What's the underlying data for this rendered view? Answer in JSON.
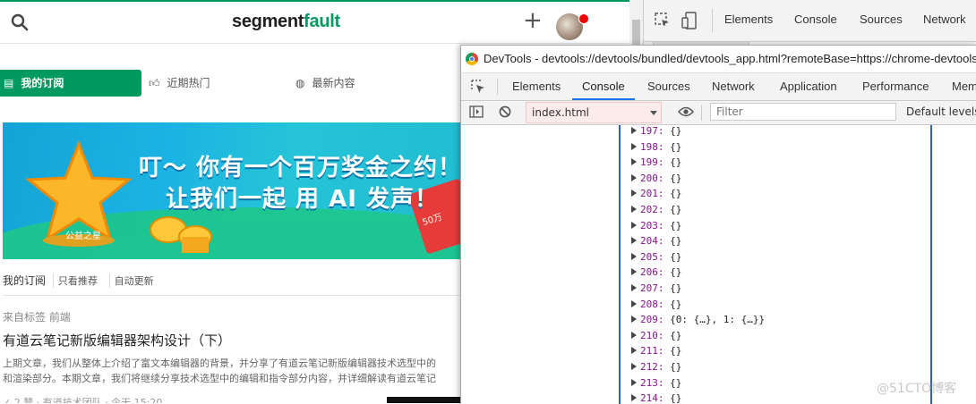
{
  "site": {
    "logo_dark": "segment",
    "logo_green": "fault",
    "plus_glyph": "+"
  },
  "nav": {
    "items": [
      {
        "label": "我的订阅",
        "icon": "subscription-icon",
        "active": true
      },
      {
        "label": "近期热门",
        "icon": "thumb-up-icon",
        "active": false
      },
      {
        "label": "最新内容",
        "icon": "compass-icon",
        "active": false
      }
    ]
  },
  "banner": {
    "line1": "叮～ 你有一个百万奖金之约！",
    "line2": "让我们一起 用 AI 发声！",
    "star_text": "公益之星",
    "envelope_text": "50万"
  },
  "feed": {
    "tab_main": "我的订阅",
    "tab_recommend": "只看推荐",
    "tab_auto": "自动更新",
    "from": "来自标签 前端",
    "title": "有道云笔记新版编辑器架构设计（下）",
    "excerpt1": "上期文章，我们从整体上介绍了富文本编辑器的背景，并分享了有道云笔记新版编辑器技术选型中的",
    "excerpt2": "和渲染部分。本期文章，我们将继续分享技术选型中的编辑和指令部分内容，并详细解读有道云笔记",
    "meta": "✓  2  赞 · 有道技术团队 · 今天 15:20"
  },
  "dock": {
    "tabs": [
      "Elements",
      "Console",
      "Sources",
      "Network"
    ]
  },
  "devtools": {
    "window_title": "DevTools - devtools://devtools/bundled/devtools_app.html?remoteBase=https://chrome-devtools-frontend",
    "tabs": [
      {
        "label": "Elements",
        "active": false
      },
      {
        "label": "Console",
        "active": true
      },
      {
        "label": "Sources",
        "active": false
      },
      {
        "label": "Network",
        "active": false
      },
      {
        "label": "Application",
        "active": false
      },
      {
        "label": "Performance",
        "active": false
      },
      {
        "label": "Mem",
        "active": false
      }
    ],
    "context": "index.html",
    "filter_placeholder": "Filter",
    "levels": "Default levels"
  },
  "console": {
    "rows": [
      {
        "index": "197:",
        "value": "{}"
      },
      {
        "index": "198:",
        "value": "{}"
      },
      {
        "index": "199:",
        "value": "{}"
      },
      {
        "index": "200:",
        "value": "{}"
      },
      {
        "index": "201:",
        "value": "{}"
      },
      {
        "index": "202:",
        "value": "{}"
      },
      {
        "index": "203:",
        "value": "{}"
      },
      {
        "index": "204:",
        "value": "{}"
      },
      {
        "index": "205:",
        "value": "{}"
      },
      {
        "index": "206:",
        "value": "{}"
      },
      {
        "index": "207:",
        "value": "{}"
      },
      {
        "index": "208:",
        "value": "{}"
      },
      {
        "index": "209:",
        "value": "{0: {…}, 1: {…}}"
      },
      {
        "index": "210:",
        "value": "{}"
      },
      {
        "index": "211:",
        "value": "{}"
      },
      {
        "index": "212:",
        "value": "{}"
      },
      {
        "index": "213:",
        "value": "{}"
      },
      {
        "index": "214:",
        "value": "{}"
      }
    ]
  },
  "watermark": "@51CTO博客",
  "colors": {
    "brand_green": "#009a61",
    "console_index": "#881391",
    "tab_underline": "#1a73e8",
    "frame_blue": "#2a5fd0"
  }
}
